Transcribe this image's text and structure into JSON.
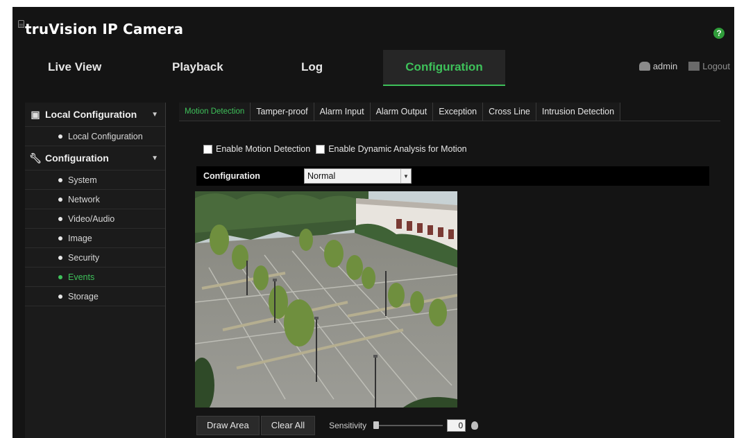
{
  "app": {
    "logo_mark": "⌸",
    "logo_text": "truVision IP Camera",
    "help_label": "?"
  },
  "nav": {
    "tabs": [
      "Live View",
      "Playback",
      "Log",
      "Configuration"
    ],
    "active": "Configuration",
    "user": "admin",
    "logout": "Logout"
  },
  "sidebar": {
    "groups": [
      {
        "label": "Local Configuration",
        "icon": "computer-icon",
        "items": [
          "Local Configuration"
        ]
      },
      {
        "label": "Configuration",
        "icon": "wrench-icon",
        "items": [
          "System",
          "Network",
          "Video/Audio",
          "Image",
          "Security",
          "Events",
          "Storage"
        ]
      }
    ],
    "active_item": "Events"
  },
  "tabs": [
    "Motion Detection",
    "Tamper-proof",
    "Alarm Input",
    "Alarm Output",
    "Exception",
    "Cross Line",
    "Intrusion Detection"
  ],
  "active_tab": "Motion Detection",
  "options": {
    "enable_motion": "Enable Motion Detection",
    "enable_dynamic": "Enable Dynamic Analysis for Motion"
  },
  "config": {
    "label": "Configuration",
    "value": "Normal"
  },
  "controls": {
    "draw_area": "Draw Area",
    "clear_all": "Clear All",
    "sensitivity_label": "Sensitivity",
    "sensitivity_value": "0"
  },
  "colors": {
    "accent": "#3ec15a",
    "background": "#141414"
  }
}
